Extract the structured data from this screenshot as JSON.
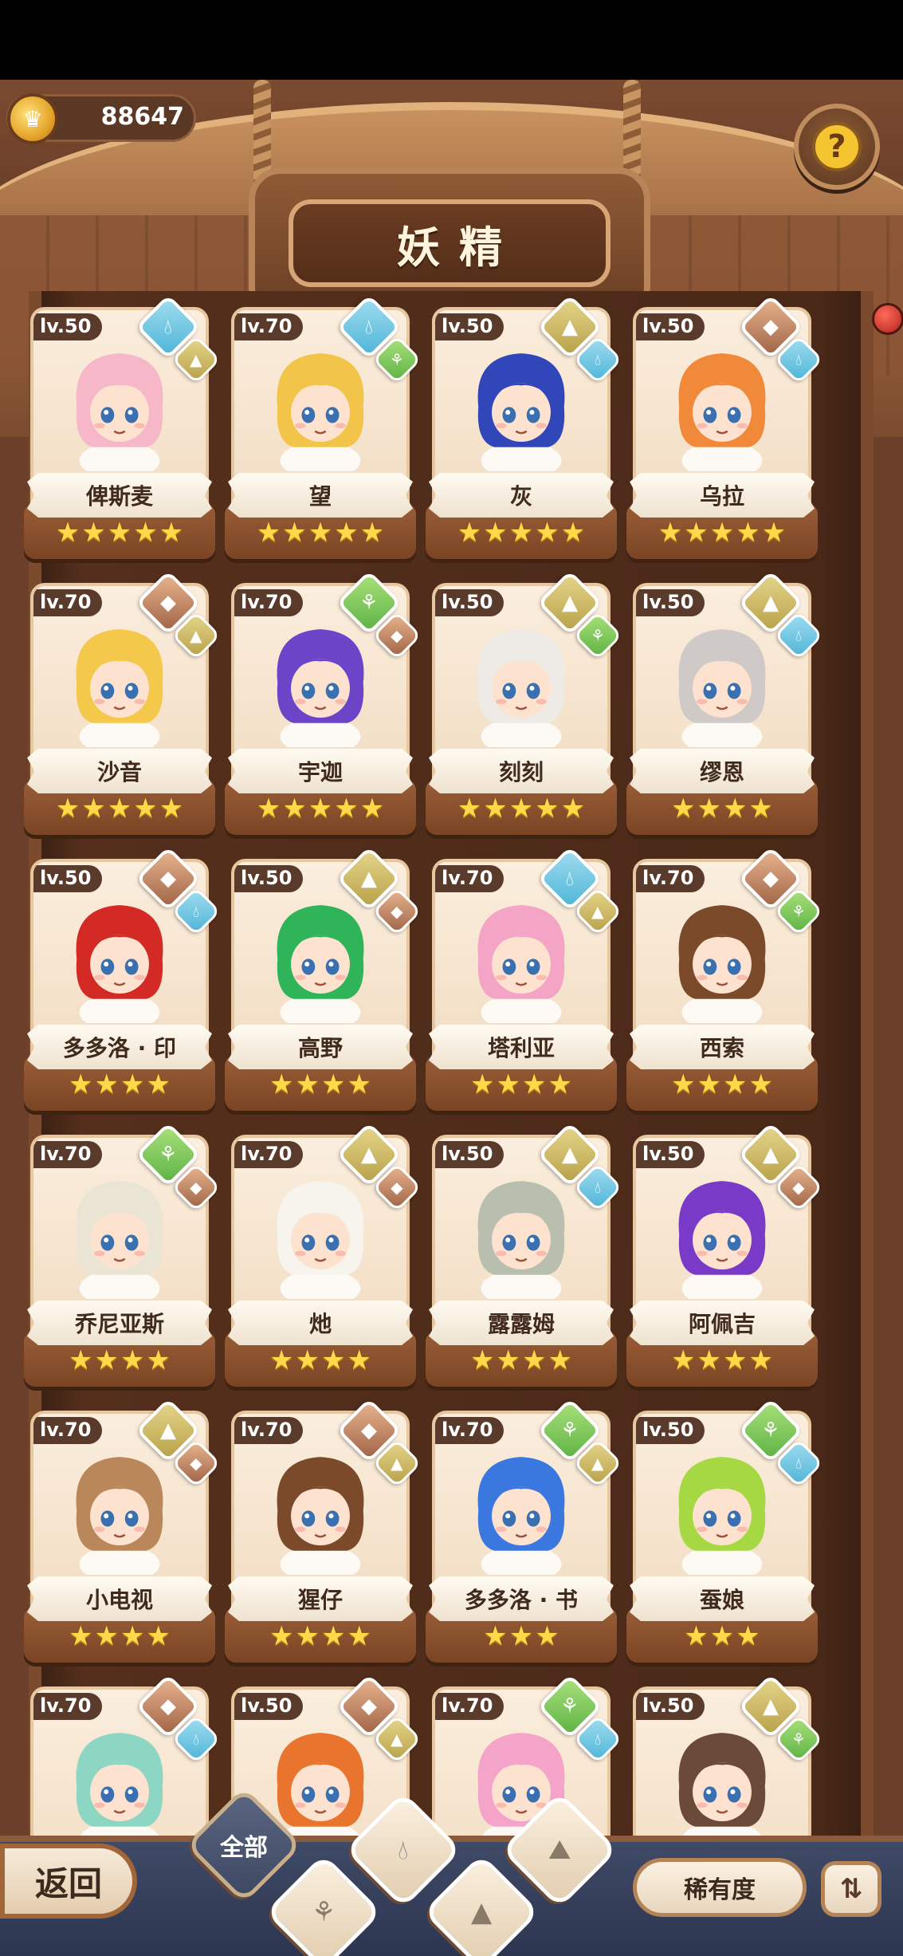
{
  "coins": {
    "value": "88647",
    "icon": "crown-coin-icon"
  },
  "title": "妖精",
  "help": {
    "label": "?"
  },
  "fairies": [
    {
      "level": "lv.50",
      "name": "俾斯麦",
      "stars": 5,
      "elements": [
        "water",
        "earth"
      ],
      "hair": "#f6b8c8"
    },
    {
      "level": "lv.70",
      "name": "望",
      "stars": 5,
      "elements": [
        "water",
        "plant"
      ],
      "hair": "#f2c54a"
    },
    {
      "level": "lv.50",
      "name": "灰",
      "stars": 5,
      "elements": [
        "earth",
        "water"
      ],
      "hair": "#3146b8"
    },
    {
      "level": "lv.50",
      "name": "乌拉",
      "stars": 5,
      "elements": [
        "fire",
        "water"
      ],
      "hair": "#f08a3a"
    },
    {
      "level": "lv.70",
      "name": "沙音",
      "stars": 5,
      "elements": [
        "fire",
        "earth"
      ],
      "hair": "#f4c84a"
    },
    {
      "level": "lv.70",
      "name": "宇迦",
      "stars": 5,
      "elements": [
        "plant",
        "fire"
      ],
      "hair": "#6b44c8"
    },
    {
      "level": "lv.50",
      "name": "刻刻",
      "stars": 5,
      "elements": [
        "earth",
        "plant"
      ],
      "hair": "#eeeae6"
    },
    {
      "level": "lv.50",
      "name": "缪恩",
      "stars": 4,
      "elements": [
        "earth",
        "water"
      ],
      "hair": "#cfcac8"
    },
    {
      "level": "lv.50",
      "name": "多多洛 · 印",
      "stars": 4,
      "elements": [
        "fire",
        "water"
      ],
      "hair": "#d32a26"
    },
    {
      "level": "lv.50",
      "name": "高野",
      "stars": 4,
      "elements": [
        "earth",
        "fire"
      ],
      "hair": "#2fb45a"
    },
    {
      "level": "lv.70",
      "name": "塔利亚",
      "stars": 4,
      "elements": [
        "water",
        "earth"
      ],
      "hair": "#f4a4c4"
    },
    {
      "level": "lv.70",
      "name": "西索",
      "stars": 4,
      "elements": [
        "fire",
        "plant"
      ],
      "hair": "#7a4a2a"
    },
    {
      "level": "lv.70",
      "name": "乔尼亚斯",
      "stars": 4,
      "elements": [
        "plant",
        "fire"
      ],
      "hair": "#e9e4d4"
    },
    {
      "level": "lv.70",
      "name": "灺",
      "stars": 4,
      "elements": [
        "earth",
        "fire"
      ],
      "hair": "#f6f4ec"
    },
    {
      "level": "lv.50",
      "name": "露露姆",
      "stars": 4,
      "elements": [
        "earth",
        "water"
      ],
      "hair": "#b8bfae"
    },
    {
      "level": "lv.50",
      "name": "阿佩吉",
      "stars": 4,
      "elements": [
        "earth",
        "fire"
      ],
      "hair": "#7a3ac8"
    },
    {
      "level": "lv.70",
      "name": "小电视",
      "stars": 4,
      "elements": [
        "earth",
        "fire"
      ],
      "hair": "#b9875a"
    },
    {
      "level": "lv.70",
      "name": "猩仔",
      "stars": 4,
      "elements": [
        "fire",
        "earth"
      ],
      "hair": "#7a4a2a"
    },
    {
      "level": "lv.70",
      "name": "多多洛 · 书",
      "stars": 3,
      "elements": [
        "plant",
        "earth"
      ],
      "hair": "#3a78e0"
    },
    {
      "level": "lv.50",
      "name": "蚕娘",
      "stars": 3,
      "elements": [
        "plant",
        "water"
      ],
      "hair": "#a6d844"
    },
    {
      "level": "lv.70",
      "name": "",
      "stars": 0,
      "elements": [
        "fire",
        "water"
      ],
      "hair": "#8ed6c4"
    },
    {
      "level": "lv.50",
      "name": "",
      "stars": 0,
      "elements": [
        "fire",
        "earth"
      ],
      "hair": "#e8742e"
    },
    {
      "level": "lv.70",
      "name": "",
      "stars": 0,
      "elements": [
        "plant",
        "water"
      ],
      "hair": "#f4a4c8"
    },
    {
      "level": "lv.50",
      "name": "",
      "stars": 0,
      "elements": [
        "earth",
        "plant"
      ],
      "hair": "#6b4a3a"
    }
  ],
  "bottom": {
    "back_label": "返回",
    "filter_all_label": "全部",
    "filters": [
      "plant",
      "water",
      "earth",
      "fire"
    ],
    "rarity_label": "稀有度",
    "sort_icon": "sort-icon"
  }
}
